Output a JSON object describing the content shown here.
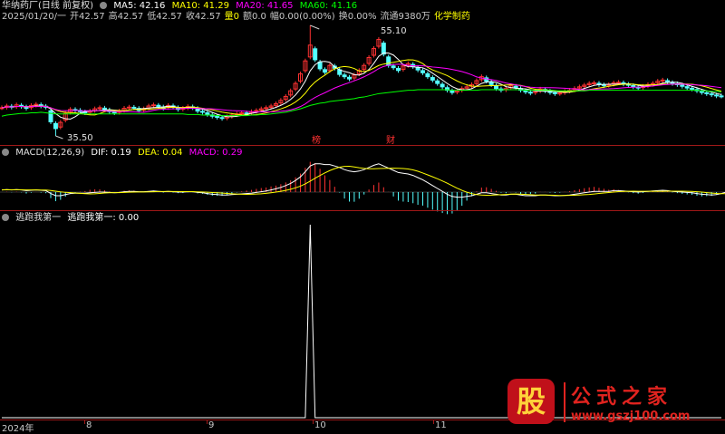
{
  "colors": {
    "up": "#ff3232",
    "down": "#54ffff",
    "ma5": "#ffffff",
    "ma10": "#ffff00",
    "ma20": "#ff00ff",
    "ma60": "#00ff00",
    "grid": "#a01818",
    "dif": "#ffffff",
    "dea": "#ffff00"
  },
  "header1": {
    "title": "华纳药厂(日线 前复权)",
    "ma5": "MA5: 42.16",
    "ma10": "MA10: 41.29",
    "ma20": "MA20: 41.65",
    "ma60": "MA60: 41.16"
  },
  "header2": {
    "date": "2025/01/20/一",
    "open": "开42.57",
    "high": "高42.57",
    "low": "低42.57",
    "close": "收42.57",
    "vol": "量0",
    "amount": "额0.0",
    "change": "幅0.00(0.00%)",
    "turnover": "换0.00%",
    "float": "流通9380万",
    "industry": "化学制药"
  },
  "annotations": {
    "high_label": "55.10",
    "low_label": "35.50",
    "marker1": "榜",
    "marker2": "财"
  },
  "macd": {
    "title": "MACD(12,26,9)",
    "dif": "DIF: 0.19",
    "dea": "DEA: 0.04",
    "macd": "MACD: 0.29"
  },
  "indicator": {
    "title": "逃跑我第一",
    "value": "逃跑我第一: 0.00"
  },
  "xaxis": {
    "labels": [
      "2024年",
      "8",
      "9",
      "10",
      "11"
    ]
  },
  "watermark": {
    "glyph": "股",
    "title": "公式之家",
    "url": "www.gszj100.com"
  },
  "chart_data": {
    "type": "line",
    "price_closes": [
      40.5,
      40.8,
      40.6,
      41.0,
      40.7,
      40.4,
      40.9,
      41.1,
      40.8,
      40.6,
      38.0,
      36.8,
      37.9,
      39.5,
      40.2,
      40.1,
      39.8,
      39.6,
      39.9,
      40.3,
      40.5,
      40.2,
      39.8,
      39.6,
      39.9,
      40.4,
      40.6,
      40.5,
      40.0,
      40.3,
      40.8,
      41.0,
      40.7,
      40.4,
      40.9,
      40.6,
      40.2,
      40.4,
      40.7,
      40.5,
      39.9,
      39.7,
      39.3,
      39.0,
      38.8,
      38.6,
      38.9,
      39.2,
      39.4,
      39.6,
      39.5,
      39.8,
      40.0,
      40.3,
      40.5,
      40.8,
      41.2,
      41.8,
      42.5,
      43.5,
      44.8,
      46.5,
      48.8,
      51.6,
      49.0,
      47.4,
      46.8,
      48.0,
      47.5,
      46.4,
      46.0,
      45.6,
      46.3,
      47.1,
      48.0,
      49.4,
      51.0,
      52.6,
      50.0,
      48.0,
      47.6,
      47.1,
      47.9,
      48.3,
      47.8,
      47.2,
      46.7,
      46.0,
      45.4,
      44.8,
      44.2,
      43.6,
      43.2,
      43.5,
      43.9,
      44.2,
      44.6,
      45.3,
      46.0,
      45.2,
      44.6,
      43.9,
      43.6,
      43.9,
      44.4,
      44.0,
      43.6,
      43.3,
      43.1,
      43.4,
      43.8,
      43.5,
      43.2,
      43.0,
      43.1,
      43.4,
      43.6,
      43.9,
      44.2,
      44.5,
      44.8,
      44.9,
      44.6,
      44.4,
      44.6,
      44.9,
      45.0,
      44.7,
      44.5,
      44.2,
      44.0,
      44.3,
      44.6,
      44.8,
      45.2,
      45.4,
      45.0,
      44.8,
      44.6,
      44.3,
      44.0,
      43.8,
      43.5,
      43.2,
      43.0,
      42.8,
      42.6,
      42.57
    ],
    "ma60": [
      39.0,
      39.2,
      39.3,
      39.4,
      39.5,
      39.5,
      39.6,
      39.6,
      39.7,
      39.6,
      39.5,
      39.4,
      39.4,
      39.4,
      39.4,
      39.4,
      39.4,
      39.4,
      39.4,
      39.4,
      39.4,
      39.4,
      39.4,
      39.4,
      39.4,
      39.4,
      39.4,
      39.4,
      39.4,
      39.4,
      39.4,
      39.4,
      39.4,
      39.4,
      39.4,
      39.4,
      39.4,
      39.4,
      39.3,
      39.3,
      39.3,
      39.2,
      39.2,
      39.2,
      39.1,
      39.1,
      39.1,
      39.1,
      39.1,
      39.1,
      39.1,
      39.2,
      39.2,
      39.3,
      39.3,
      39.4,
      39.5,
      39.6,
      39.7,
      39.9,
      40.1,
      40.3,
      40.6,
      40.9,
      41.1,
      41.3,
      41.4,
      41.6,
      41.7,
      41.8,
      41.9,
      42.0,
      42.1,
      42.3,
      42.4,
      42.6,
      42.8,
      43.0,
      43.1,
      43.2,
      43.3,
      43.4,
      43.5,
      43.6,
      43.6,
      43.7,
      43.7,
      43.7,
      43.7,
      43.7,
      43.7,
      43.7,
      43.6,
      43.6,
      43.6,
      43.6,
      43.6,
      43.6,
      43.7,
      43.7,
      43.7,
      43.7,
      43.7,
      43.7,
      43.7,
      43.7,
      43.7,
      43.6,
      43.6,
      43.6,
      43.6,
      43.6,
      43.6,
      43.5,
      43.5,
      43.5,
      43.5,
      43.5,
      43.5,
      43.5,
      43.6,
      43.6,
      43.6,
      43.6,
      43.6,
      43.6,
      43.6,
      43.6,
      43.6,
      43.6,
      43.6,
      43.6,
      43.6,
      43.6,
      43.6,
      43.6,
      43.6,
      43.6,
      43.6,
      43.6,
      43.6,
      43.6,
      43.6,
      43.5,
      43.5,
      43.4,
      43.4,
      43.3
    ],
    "dif": [
      0.3,
      0.35,
      0.3,
      0.35,
      0.3,
      0.2,
      0.25,
      0.3,
      0.25,
      0.2,
      -0.2,
      -0.5,
      -0.5,
      -0.35,
      -0.2,
      -0.15,
      -0.15,
      -0.15,
      -0.1,
      -0.05,
      0.0,
      0.0,
      -0.05,
      -0.1,
      -0.05,
      0.05,
      0.1,
      0.1,
      0.05,
      0.05,
      0.1,
      0.15,
      0.1,
      0.05,
      0.1,
      0.05,
      0.0,
      0.0,
      0.05,
      0.05,
      -0.05,
      -0.1,
      -0.2,
      -0.3,
      -0.35,
      -0.4,
      -0.4,
      -0.35,
      -0.3,
      -0.25,
      -0.2,
      -0.15,
      -0.05,
      0.05,
      0.15,
      0.3,
      0.45,
      0.65,
      0.9,
      1.2,
      1.6,
      2.1,
      2.8,
      3.6,
      3.9,
      3.9,
      3.8,
      3.8,
      3.6,
      3.4,
      3.1,
      2.9,
      2.8,
      2.9,
      3.1,
      3.4,
      3.7,
      3.9,
      3.6,
      3.3,
      3.0,
      2.7,
      2.6,
      2.5,
      2.3,
      2.0,
      1.7,
      1.3,
      0.9,
      0.5,
      0.1,
      -0.3,
      -0.6,
      -0.7,
      -0.7,
      -0.6,
      -0.5,
      -0.3,
      -0.1,
      -0.1,
      -0.2,
      -0.3,
      -0.4,
      -0.4,
      -0.3,
      -0.3,
      -0.4,
      -0.5,
      -0.5,
      -0.5,
      -0.4,
      -0.4,
      -0.45,
      -0.5,
      -0.5,
      -0.45,
      -0.4,
      -0.3,
      -0.2,
      -0.1,
      0.0,
      0.1,
      0.1,
      0.1,
      0.1,
      0.2,
      0.2,
      0.15,
      0.1,
      0.05,
      0.0,
      0.05,
      0.1,
      0.15,
      0.2,
      0.25,
      0.2,
      0.1,
      0.05,
      0.0,
      -0.05,
      -0.1,
      -0.2,
      -0.3,
      -0.35,
      -0.4,
      -0.35,
      -0.2,
      0.0,
      0.19
    ],
    "signal_peak_index": 63,
    "signal_peak_value": 1.0
  }
}
